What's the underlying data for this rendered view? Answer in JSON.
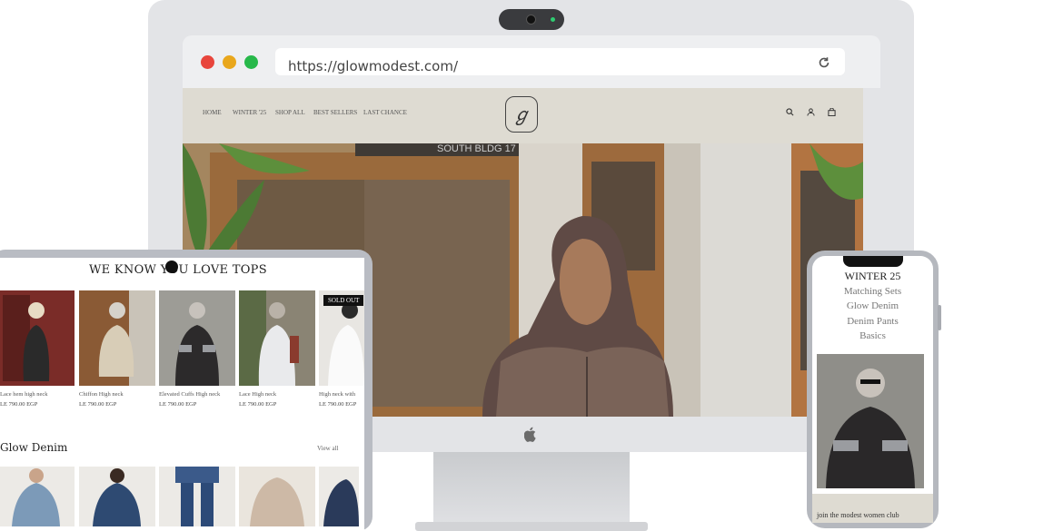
{
  "browser": {
    "url": "https://glowmodest.com/",
    "reload_icon": "reload-icon"
  },
  "site": {
    "logo_text": "ℊ",
    "nav": [
      "HOME",
      "WINTER '25",
      "SHOP ALL",
      "BEST SELLERS",
      "LAST CHANCE"
    ],
    "icons": [
      "search-icon",
      "account-icon",
      "bag-icon"
    ],
    "hero_sign": "SOUTH BLDG 17"
  },
  "tablet": {
    "section_title": "WE KNOW YOU LOVE TOPS",
    "products": [
      {
        "name": "Lace hem high neck",
        "price": "LE 790.00 EGP"
      },
      {
        "name": "Chiffon High neck",
        "price": "LE 790.00 EGP"
      },
      {
        "name": "Elevated Cuffs High neck",
        "price": "LE 790.00 EGP"
      },
      {
        "name": "Lace High neck",
        "price": "LE 790.00 EGP"
      },
      {
        "name": "High neck with",
        "price": "LE 790.00 EGP"
      }
    ],
    "sold_out": "SOLD OUT",
    "denim_title": "Glow Denim",
    "view_all": "View all"
  },
  "phone": {
    "menu_head": "WINTER 25",
    "menu": [
      "Matching Sets",
      "Glow Denim",
      "Denim Pants",
      "Basics"
    ],
    "club": "join the modest women club"
  },
  "colors": {
    "site_bg": "#dedbd2",
    "device_frame": "#e3e4e7",
    "dot_red": "#e8453c",
    "dot_yellow": "#e9a71c",
    "dot_green": "#27b84a"
  }
}
